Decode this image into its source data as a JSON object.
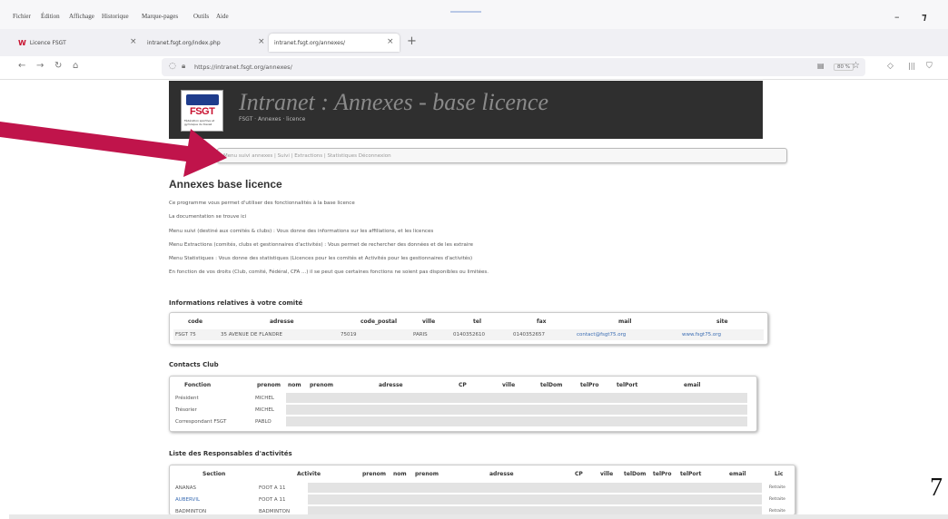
{
  "browser": {
    "menu": [
      "Fichier",
      "Édition",
      "Affichage",
      "Historique",
      "Marque-pages",
      "Outils",
      "Aide"
    ],
    "tabs": [
      {
        "label": "Licence FSGT"
      },
      {
        "label": "intranet.fsgt.org/index.php"
      },
      {
        "label": "intranet.fsgt.org/annexes/"
      }
    ],
    "url": "https://intranet.fsgt.org/annexes/",
    "zoom": "80 %"
  },
  "banner": {
    "title": "Intranet : Annexes - base licence",
    "breadcrumb": "FSGT · Annexes · licence",
    "logo_text": "FSGT",
    "logo_subtext": "Fédération sportive et gymnique du travail"
  },
  "nav": {
    "text": "Menu suivi annexes | Suivi | Extractions | Statistiques     Déconnexion"
  },
  "page": {
    "heading": "Annexes base licence",
    "paragraphs": [
      "Ce programme vous permet d'utiliser des fonctionnalités à la base licence",
      "La documentation se trouve ici",
      "Menu suivi (destiné aux comités & clubs) : Vous donne des informations sur les affiliations, et les licences",
      "Menu Extractions (comités, clubs et gestionnaires d'activités) : Vous permet de rechercher des données et de les extraire",
      "Menu Statistiques : Vous donne des statistiques (Licences pour les comités et Activités pour les gestionnaires d'activités)",
      "En fonction de vos droits (Club, comité, Fédéral, CFA ...) il se peut que certaines fonctions ne soient pas disponibles ou limitées."
    ]
  },
  "committee": {
    "heading": "Informations relatives à votre comité",
    "columns": [
      "code",
      "adresse",
      "code_postal",
      "ville",
      "tel",
      "fax",
      "mail",
      "site"
    ],
    "row": [
      "FSGT 75",
      "35 AVENUE DE FLANDRE",
      "75019",
      "PARIS",
      "0140352610",
      "0140352657",
      "contact@fsgt75.org",
      "www.fsgt75.org"
    ]
  },
  "contacts": {
    "heading": "Contacts Club",
    "columns": [
      "Fonction",
      "prenom",
      "nom",
      "prenom",
      "adresse",
      "CP",
      "ville",
      "telDom",
      "telPro",
      "telPort",
      "email"
    ],
    "rows": [
      {
        "fonction": "Président",
        "prenom": "MICHEL"
      },
      {
        "fonction": "Trésorier",
        "prenom": "MICHEL"
      },
      {
        "fonction": "Correspondant FSGT",
        "prenom": "PABLO"
      }
    ]
  },
  "activites": {
    "heading": "Liste des Responsables d'activités",
    "columns": [
      "Section",
      "Activite",
      "prenom",
      "nom",
      "prenom",
      "adresse",
      "CP",
      "ville",
      "telDom",
      "telPro",
      "telPort",
      "email",
      "Lic"
    ],
    "rows": [
      {
        "section": "ANANAS",
        "activite": "FOOT A 11",
        "lic": "Retraite"
      },
      {
        "section": "AUBERVIL",
        "activite": "FOOT A 11",
        "lic": "Retraite"
      },
      {
        "section": "BADMINTON",
        "activite": "BADMINTON",
        "lic": "Retraite"
      }
    ]
  },
  "slide_number": "7",
  "annotation_color": "#c0144b"
}
